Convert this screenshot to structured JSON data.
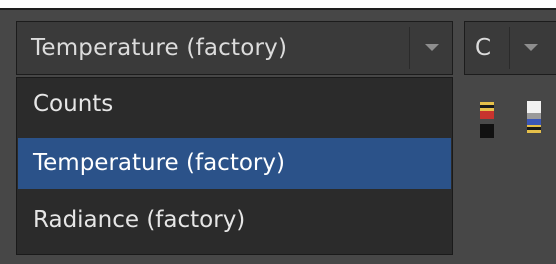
{
  "primary_select": {
    "selected_label": "Temperature (factory)",
    "options": [
      "Counts",
      "Temperature (factory)",
      "Radiance (factory)"
    ],
    "selected_index": 1
  },
  "secondary_select": {
    "selected_label": "C"
  },
  "icons": {
    "arrow": "chevron-down-icon",
    "tool_increase": "level-up-icon",
    "tool_decrease": "level-down-icon"
  },
  "colors": {
    "selection": "#2b5289",
    "background": "#474747",
    "control": "#3a3a3a"
  }
}
